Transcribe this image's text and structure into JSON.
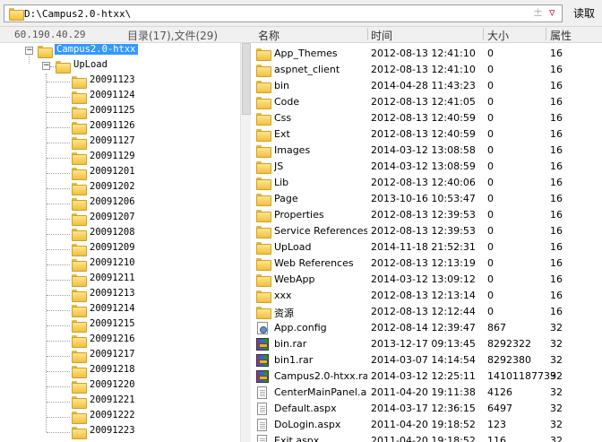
{
  "address": {
    "path": "D:\\Campus2.0-htxx\\",
    "read_label": "读取"
  },
  "left_status": {
    "ip": "60.190.40.29",
    "counts": "目录(17),文件(29)"
  },
  "tree": {
    "root": {
      "label": "Campus2.0-htxx"
    },
    "upload": {
      "label": "UpLoad"
    },
    "children": [
      "20091123",
      "20091124",
      "20091125",
      "20091126",
      "20091127",
      "20091129",
      "20091201",
      "20091202",
      "20091206",
      "20091207",
      "20091208",
      "20091209",
      "20091210",
      "20091211",
      "20091213",
      "20091214",
      "20091215",
      "20091216",
      "20091217",
      "20091218",
      "20091220",
      "20091221",
      "20091222",
      "20091223"
    ]
  },
  "columns": {
    "name": "名称",
    "time": "时间",
    "size": "大小",
    "attr": "属性"
  },
  "files": [
    {
      "name": "App_Themes",
      "time": "2012-08-13 12:41:10",
      "size": "0",
      "attr": "16",
      "icon": "folder-icon"
    },
    {
      "name": "aspnet_client",
      "time": "2012-08-13 12:41:10",
      "size": "0",
      "attr": "16",
      "icon": "folder-icon"
    },
    {
      "name": "bin",
      "time": "2014-04-28 11:43:23",
      "size": "0",
      "attr": "16",
      "icon": "folder-icon"
    },
    {
      "name": "Code",
      "time": "2012-08-13 12:41:05",
      "size": "0",
      "attr": "16",
      "icon": "folder-icon"
    },
    {
      "name": "Css",
      "time": "2012-08-13 12:40:59",
      "size": "0",
      "attr": "16",
      "icon": "folder-icon"
    },
    {
      "name": "Ext",
      "time": "2012-08-13 12:40:59",
      "size": "0",
      "attr": "16",
      "icon": "folder-icon"
    },
    {
      "name": "Images",
      "time": "2014-03-12 13:08:58",
      "size": "0",
      "attr": "16",
      "icon": "folder-icon"
    },
    {
      "name": "JS",
      "time": "2014-03-12 13:08:59",
      "size": "0",
      "attr": "16",
      "icon": "folder-icon"
    },
    {
      "name": "Lib",
      "time": "2012-08-13 12:40:06",
      "size": "0",
      "attr": "16",
      "icon": "folder-icon"
    },
    {
      "name": "Page",
      "time": "2013-10-16 10:53:47",
      "size": "0",
      "attr": "16",
      "icon": "folder-icon"
    },
    {
      "name": "Properties",
      "time": "2012-08-13 12:39:53",
      "size": "0",
      "attr": "16",
      "icon": "folder-icon"
    },
    {
      "name": "Service References",
      "time": "2012-08-13 12:39:53",
      "size": "0",
      "attr": "16",
      "icon": "folder-icon"
    },
    {
      "name": "UpLoad",
      "time": "2014-11-18 21:52:31",
      "size": "0",
      "attr": "16",
      "icon": "folder-icon"
    },
    {
      "name": "Web References",
      "time": "2012-08-13 12:13:19",
      "size": "0",
      "attr": "16",
      "icon": "folder-icon"
    },
    {
      "name": "WebApp",
      "time": "2014-03-12 13:09:12",
      "size": "0",
      "attr": "16",
      "icon": "folder-icon"
    },
    {
      "name": "xxx",
      "time": "2012-08-13 12:13:14",
      "size": "0",
      "attr": "16",
      "icon": "folder-icon"
    },
    {
      "name": "资源",
      "time": "2012-08-13 12:12:44",
      "size": "0",
      "attr": "16",
      "icon": "folder-icon"
    },
    {
      "name": "App.config",
      "time": "2012-08-14 12:39:47",
      "size": "867",
      "attr": "32",
      "icon": "config-file-icon"
    },
    {
      "name": "bin.rar",
      "time": "2013-12-17 09:13:45",
      "size": "8292322",
      "attr": "32",
      "icon": "rar-archive-icon"
    },
    {
      "name": "bin1.rar",
      "time": "2014-03-07 14:14:54",
      "size": "8292380",
      "attr": "32",
      "icon": "rar-archive-icon"
    },
    {
      "name": "Campus2.0-htxx.rar",
      "time": "2014-03-12 12:25:11",
      "size": "14101187739",
      "attr": "32",
      "icon": "rar-archive-icon"
    },
    {
      "name": "CenterMainPanel.as...",
      "time": "2011-04-20 19:11:38",
      "size": "4126",
      "attr": "32",
      "icon": "file-icon"
    },
    {
      "name": "Default.aspx",
      "time": "2014-03-17 12:36:15",
      "size": "6497",
      "attr": "32",
      "icon": "file-icon"
    },
    {
      "name": "DoLogin.aspx",
      "time": "2011-04-20 19:18:52",
      "size": "123",
      "attr": "32",
      "icon": "file-icon"
    },
    {
      "name": "Exit.aspx",
      "time": "2011-04-20 19:18:52",
      "size": "116",
      "attr": "32",
      "icon": "file-icon"
    }
  ]
}
